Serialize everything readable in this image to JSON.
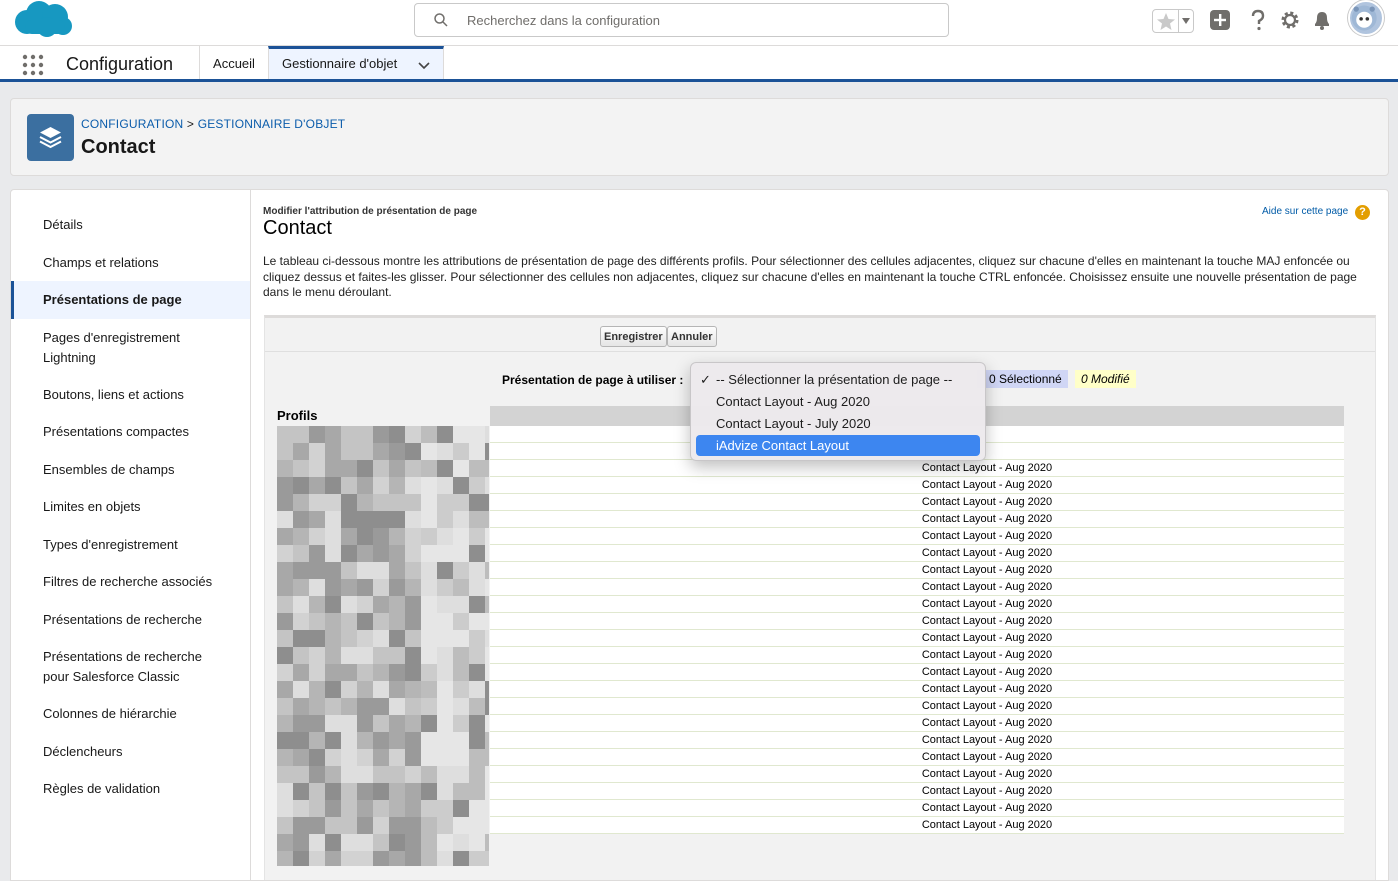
{
  "header": {
    "search_placeholder": "Recherchez dans la configuration"
  },
  "appnav": {
    "app_name": "Configuration",
    "tabs": [
      {
        "label": "Accueil"
      },
      {
        "label": "Gestionnaire d'objet"
      }
    ]
  },
  "page_header": {
    "breadcrumb_1": "CONFIGURATION",
    "breadcrumb_sep": ">",
    "breadcrumb_2": "GESTIONNAIRE D'OBJET",
    "title": "Contact"
  },
  "sidebar": {
    "items": [
      {
        "label": "Détails"
      },
      {
        "label": "Champs et relations"
      },
      {
        "label": "Présentations de page"
      },
      {
        "label": "Pages d'enregistrement Lightning"
      },
      {
        "label": "Boutons, liens et actions"
      },
      {
        "label": "Présentations compactes"
      },
      {
        "label": "Ensembles de champs"
      },
      {
        "label": "Limites en objets"
      },
      {
        "label": "Types d'enregistrement"
      },
      {
        "label": "Filtres de recherche associés"
      },
      {
        "label": "Présentations de recherche"
      },
      {
        "label": "Présentations de recherche pour Salesforce Classic"
      },
      {
        "label": "Colonnes de hiérarchie"
      },
      {
        "label": "Déclencheurs"
      },
      {
        "label": "Règles de validation"
      }
    ],
    "active_index": 2
  },
  "content": {
    "subtitle": "Modifier l'attribution de présentation de page",
    "title": "Contact",
    "help_link": "Aide sur cette page",
    "description": "Le tableau ci-dessous montre les attributions de présentation de page des différents profils. Pour sélectionner des cellules adjacentes, cliquez sur chacune d'elles en maintenant la touche MAJ enfoncée ou cliquez dessus et faites-les glisser. Pour sélectionner des cellules non adjacentes, cliquez sur chacune d'elles en maintenant la touche CTRL enfoncée. Choisissez ensuite une nouvelle présentation de page dans le menu déroulant.",
    "save_label": "Enregistrer",
    "cancel_label": "Annuler",
    "layout_label": "Présentation de page à utiliser :",
    "selected_badge": "0 Sélectionné",
    "modified_badge": "0 Modifié",
    "profiles_label": "Profils",
    "row_value": "Contact Layout - Aug 2020",
    "row_count": 24
  },
  "dropdown": {
    "options": [
      {
        "label": "-- Sélectionner la présentation de page --",
        "checked": true
      },
      {
        "label": "Contact Layout - Aug 2020"
      },
      {
        "label": "Contact Layout - July 2020"
      },
      {
        "label": "iAdvize Contact Layout",
        "highlighted": true
      }
    ]
  },
  "colors": {
    "brand": "#1b5297",
    "link": "#0b5cab",
    "dropdown_highlight": "#3d86f0"
  }
}
